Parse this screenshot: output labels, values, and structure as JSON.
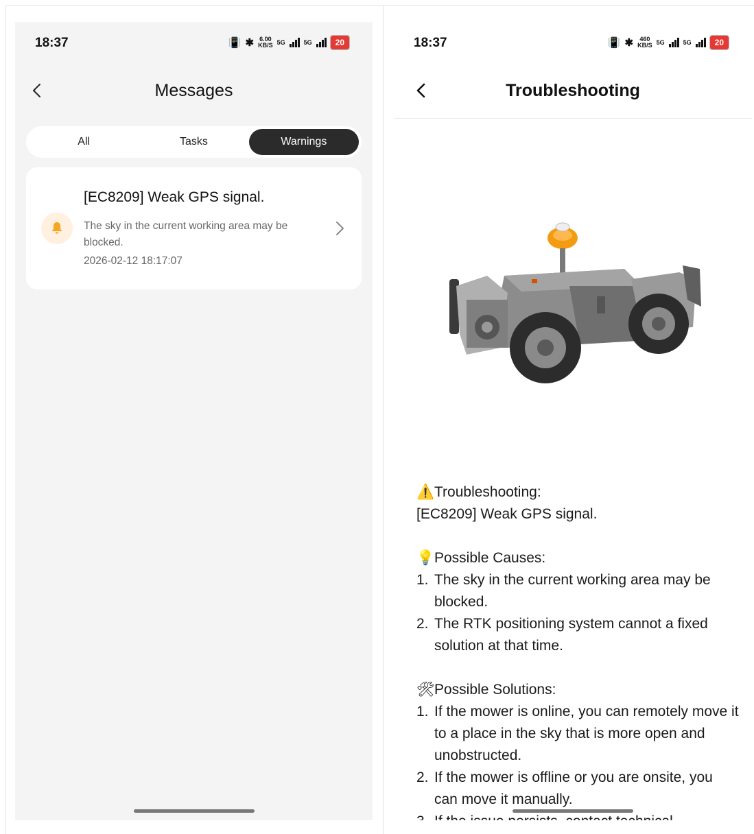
{
  "left": {
    "status": {
      "time": "18:37",
      "speed_top": "6.00",
      "speed_unit": "KB/S",
      "net1": "5G",
      "net2": "5G",
      "battery": "20"
    },
    "nav": {
      "title": "Messages"
    },
    "tabs": [
      {
        "label": "All",
        "active": false
      },
      {
        "label": "Tasks",
        "active": false
      },
      {
        "label": "Warnings",
        "active": true
      }
    ],
    "message": {
      "title": "[EC8209] Weak GPS signal.",
      "description": "The sky in the current working area may be blocked.",
      "timestamp": "2026-02-12 18:17:07",
      "icon": "bell-icon"
    }
  },
  "right": {
    "status": {
      "time": "18:37",
      "speed_top": "460",
      "speed_unit": "KB/S",
      "net1": "5G",
      "net2": "5G",
      "battery": "20"
    },
    "nav": {
      "title": "Troubleshooting"
    },
    "content": {
      "heading_emoji": "⚠️",
      "heading": "Troubleshooting:",
      "code_line": "[EC8209] Weak GPS signal.",
      "causes_emoji": "💡",
      "causes_heading": "Possible Causes:",
      "causes": [
        {
          "num": "1.",
          "text": "The sky in the current working area may be blocked."
        },
        {
          "num": "2.",
          "text": "The RTK positioning system cannot a fixed solution at that time."
        }
      ],
      "solutions_emoji": "🛠",
      "solutions_heading": "Possible Solutions:",
      "solutions": [
        {
          "num": "1.",
          "text": "If the mower is online, you can remotely move it to a place in the sky that is more open and unobstructed."
        },
        {
          "num": "2.",
          "text": "If the mower is offline or you are onsite, you can move it manually."
        },
        {
          "num": "3.",
          "text": "If the issue persists, contact technical"
        }
      ]
    }
  },
  "colors": {
    "accent_dark": "#2b2b2b",
    "bell_orange": "#f5a623",
    "battery_red": "#e53935"
  }
}
